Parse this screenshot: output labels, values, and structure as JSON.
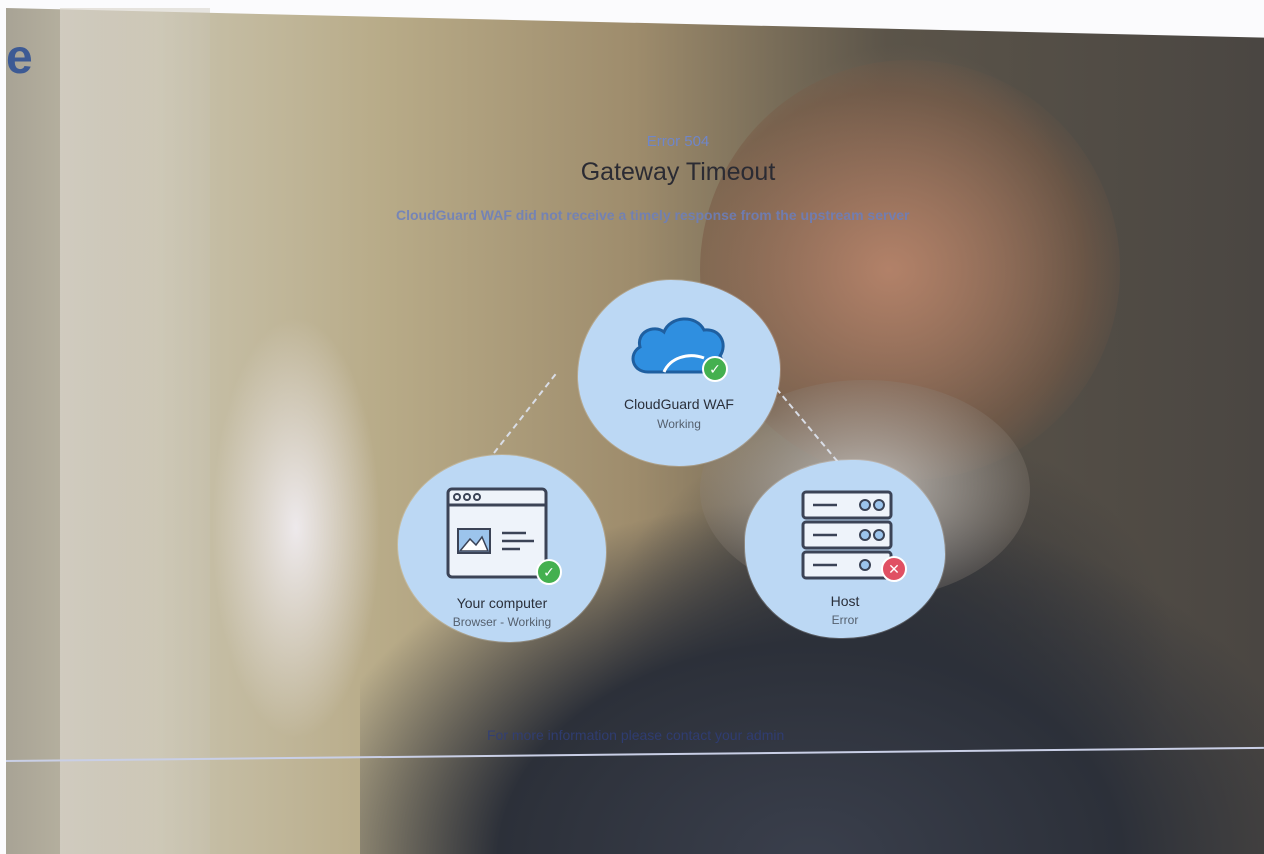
{
  "edge_text": "e",
  "error": {
    "code": "Error 504",
    "title": "Gateway Timeout",
    "description": "CloudGuard WAF did not receive a timely response from the upstream server"
  },
  "nodes": {
    "waf": {
      "label": "CloudGuard WAF",
      "status": "Working",
      "icon": "cloud-icon",
      "badge": "check"
    },
    "computer": {
      "label": "Your computer",
      "status": "Browser - Working",
      "icon": "browser-window-icon",
      "badge": "check"
    },
    "host": {
      "label": "Host",
      "status": "Error",
      "icon": "server-icon",
      "badge": "x"
    }
  },
  "footer": {
    "text": "For more information please contact your admin"
  },
  "colors": {
    "node_bg": "#bcd8f4",
    "ok": "#44b04f",
    "error": "#e05063",
    "accent": "#6f86c9"
  }
}
